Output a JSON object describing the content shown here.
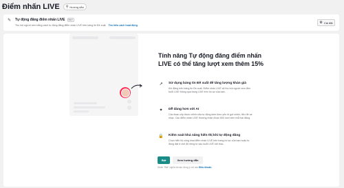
{
  "header": {
    "title": "Điểm nhấn LIVE",
    "guide_label": "Hướng dẫn",
    "guide_icon": "location-pin-icon"
  },
  "banner": {
    "icon": "sparkle-edit-icon",
    "title": "Tự động đăng điểm nhấn LIVE",
    "badge": "Mới",
    "description": "Thu hút người xem bằng cách tự động đăng điểm nhấn LIVE trên bảng tin Đề xuất.",
    "link": "Tìm hiểu cách hoạt động",
    "settings_label": "Cài đặt",
    "settings_icon": "gear-icon"
  },
  "promo": {
    "headline": "Tính năng Tự động đăng điểm nhấn LIVE có thể tăng lượt xem thêm 15%",
    "features": [
      {
        "icon": "trend-up-icon",
        "title": "Sử dụng bảng tin Đề xuất để tăng lượng khán giả",
        "description": "Khi đăng trên bảng tin Đề xuất, Điểm nhấn LIVE sẽ thu hút người xem đến buổi LIVE thông qua trang LIVE trên hồ sơ của bạn."
      },
      {
        "icon": "sparkle-icon",
        "title": "Dễ dàng hơn với AI",
        "description": "Các đoạn clip được chỉnh sửa tự động kèm theo yếu tố gợi chiến, tiêu đề và nhạc. Các điểm nhấn LIVE thường nhận được 800 lượt xem mỗi bài đăng."
      },
      {
        "icon": "lock-icon",
        "title": "Kiểm soát khả năng hiển thị khi tự động đăng",
        "description": "Chọn hiển thị công khai điểm nhấn LIVE trên trang hồ sơ của bạn hoặc tự động đặt ở chế độ riêng tư sau buổi LIVE kết thúc."
      }
    ],
    "primary_button": "Bật",
    "secondary_button": "Xem hướng dẫn",
    "footnote": "Nhấn \"Bật\" nghĩa là bạn đồng ý với các",
    "footnote_link": "Điều khoản."
  }
}
